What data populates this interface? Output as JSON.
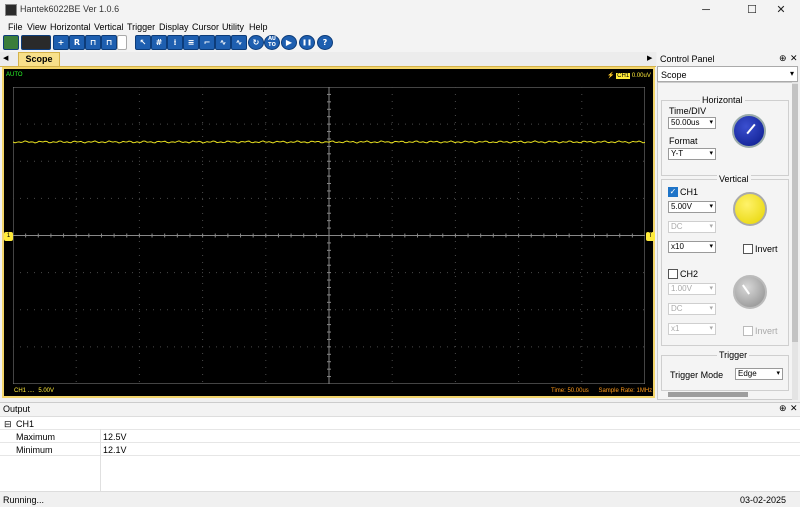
{
  "window": {
    "title": "Hantek6022BE Ver 1.0.6",
    "minimize": "─",
    "maximize": "☐",
    "close": "✕"
  },
  "menu": [
    "File",
    "View",
    "Horizontal",
    "Vertical",
    "Trigger",
    "Display",
    "Cursor",
    "Utility",
    "Help"
  ],
  "toolbar_icons": [
    "open-icon",
    "save-icon",
    "print-icon",
    "add-icon",
    "reset-icon",
    "pulse-icon",
    "square-wave-icon",
    "sine-icon",
    "cursor-icon",
    "grid-icon",
    "dots-icon",
    "lines-icon",
    "step-icon",
    "wave-icon",
    "wave-alt-icon",
    "refresh-icon",
    "auto-icon",
    "play-icon",
    "pause-icon",
    "help-icon"
  ],
  "toolbar_labels": {
    "reset": "R",
    "auto": "AU TO",
    "help": "?",
    "play": "▶",
    "pause": "❚❚",
    "refresh": "↻"
  },
  "tabs": {
    "scope": "Scope",
    "left_arrow": "◀",
    "right_arrow": "▶"
  },
  "scope": {
    "mode": "AUTO",
    "trigger": {
      "channel": "CH1",
      "level": "0.00uV"
    },
    "ch1_status": {
      "name": "CH1 ....",
      "volts_div": "5.00V"
    },
    "time": "Time: 50.00us",
    "sample_rate": "Sample Rate: 1MHz",
    "trace_color": "#e8e020",
    "trace_level_fraction": 0.815,
    "marker_left": "1",
    "marker_right": "T"
  },
  "control_panel": {
    "title": "Control Panel",
    "pin": "⊕",
    "close": "✕",
    "selected": "Scope",
    "horizontal": {
      "title": "Horizontal",
      "time_div_label": "Time/DIV",
      "time_div": "50.00us",
      "format_label": "Format",
      "format": "Y-T"
    },
    "vertical": {
      "title": "Vertical",
      "ch1": {
        "label": "CH1",
        "checked": true,
        "volts": "5.00V",
        "coupling": "DC",
        "probe": "x10",
        "invert": "Invert"
      },
      "ch2": {
        "label": "CH2",
        "checked": false,
        "volts": "1.00V",
        "coupling": "DC",
        "probe": "x1",
        "invert": "Invert"
      }
    },
    "trigger": {
      "title": "Trigger",
      "mode_label": "Trigger Mode",
      "mode": "Edge"
    }
  },
  "output": {
    "title": "Output",
    "pin": "⊕",
    "close": "✕",
    "group": "CH1",
    "collapse": "⊟",
    "rows": [
      {
        "name": "Maximum",
        "value": "12.5V"
      },
      {
        "name": "Minimum",
        "value": "12.1V"
      }
    ]
  },
  "status": {
    "text": "Running...",
    "date": "03-02-2025"
  },
  "colors": {
    "scope_bg": "#000000",
    "grid": "#4a4a4a",
    "ch1": "#ffeb3b",
    "accent": "#1e5fb0"
  }
}
